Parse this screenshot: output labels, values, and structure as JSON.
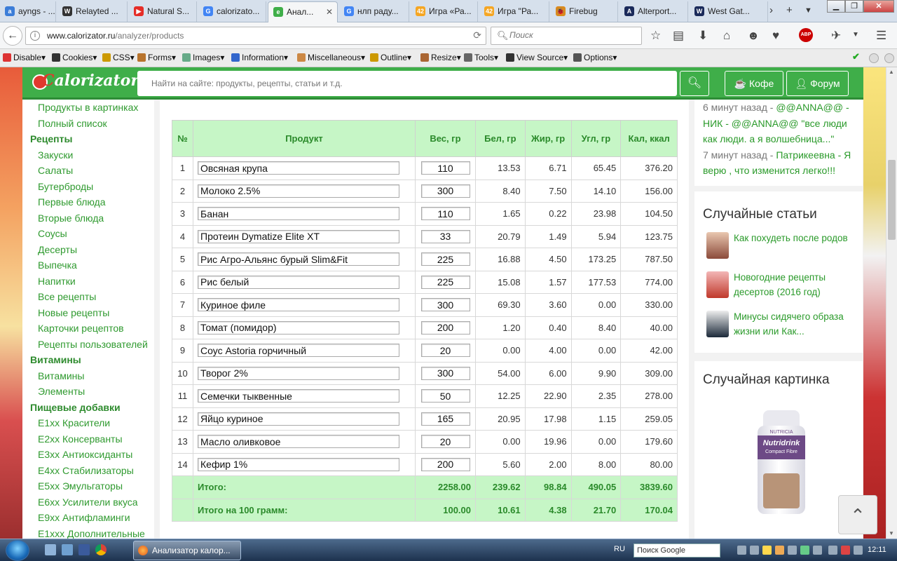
{
  "browser": {
    "tabs": [
      {
        "label": "ayngs - ...",
        "color": "#3b7dd8",
        "glyph": "a"
      },
      {
        "label": "Relayted ...",
        "color": "#333333",
        "glyph": "W"
      },
      {
        "label": "Natural S...",
        "color": "#e52d27",
        "glyph": "▶"
      },
      {
        "label": "calorizato...",
        "color": "#4285f4",
        "glyph": "G"
      },
      {
        "label": "Анал...",
        "color": "#3fae49",
        "glyph": "e",
        "active": true
      },
      {
        "label": "нлп раду...",
        "color": "#4285f4",
        "glyph": "G"
      },
      {
        "label": "Игра «Ра...",
        "color": "#f5a623",
        "glyph": "42"
      },
      {
        "label": "Игра \"Ра...",
        "color": "#f5a623",
        "glyph": "42"
      },
      {
        "label": "Firebug",
        "color": "#d98a1e",
        "glyph": "🐞"
      },
      {
        "label": "Alterport...",
        "color": "#1a2a5a",
        "glyph": "A"
      },
      {
        "label": "West Gat...",
        "color": "#1a2a5a",
        "glyph": "W"
      }
    ],
    "url_host": "www.calorizator.ru",
    "url_path": "/analyzer/products",
    "search_placeholder": "Поиск",
    "abp_label": "ABP"
  },
  "devbar": [
    {
      "label": "Disable",
      "color": "#d33"
    },
    {
      "label": "Cookies",
      "color": "#333"
    },
    {
      "label": "CSS",
      "color": "#c90"
    },
    {
      "label": "Forms",
      "color": "#b8742d"
    },
    {
      "label": "Images",
      "color": "#6a8"
    },
    {
      "label": "Information",
      "color": "#36c"
    },
    {
      "label": "Miscellaneous",
      "color": "#c84"
    },
    {
      "label": "Outline",
      "color": "#c90"
    },
    {
      "label": "Resize",
      "color": "#a63"
    },
    {
      "label": "Tools",
      "color": "#666"
    },
    {
      "label": "View Source",
      "color": "#333"
    },
    {
      "label": "Options",
      "color": "#555"
    }
  ],
  "site": {
    "logo": "alorizator",
    "logo_first": "C",
    "search_placeholder": "Найти на сайте: продукты, рецепты, статьи и т.д.",
    "coffee_label": "Кофе",
    "forum_label": "Форум"
  },
  "sidebar": [
    {
      "label": "Продукты в картинках",
      "type": "item"
    },
    {
      "label": "Полный список",
      "type": "item"
    },
    {
      "label": "Рецепты",
      "type": "cat"
    },
    {
      "label": "Закуски",
      "type": "item"
    },
    {
      "label": "Салаты",
      "type": "item"
    },
    {
      "label": "Бутерброды",
      "type": "item"
    },
    {
      "label": "Первые блюда",
      "type": "item"
    },
    {
      "label": "Вторые блюда",
      "type": "item"
    },
    {
      "label": "Соусы",
      "type": "item"
    },
    {
      "label": "Десерты",
      "type": "item"
    },
    {
      "label": "Выпечка",
      "type": "item"
    },
    {
      "label": "Напитки",
      "type": "item"
    },
    {
      "label": "Все рецепты",
      "type": "item"
    },
    {
      "label": "Новые рецепты",
      "type": "item"
    },
    {
      "label": "Карточки рецептов",
      "type": "item"
    },
    {
      "label": "Рецепты пользователей",
      "type": "item"
    },
    {
      "label": "Витамины",
      "type": "cat"
    },
    {
      "label": "Витамины",
      "type": "item"
    },
    {
      "label": "Элементы",
      "type": "item"
    },
    {
      "label": "Пищевые добавки",
      "type": "cat"
    },
    {
      "label": "E1xx Красители",
      "type": "item"
    },
    {
      "label": "E2xx Консерванты",
      "type": "item"
    },
    {
      "label": "E3xx Антиоксиданты",
      "type": "item"
    },
    {
      "label": "E4xx Стабилизаторы",
      "type": "item"
    },
    {
      "label": "E5xx Эмульгаторы",
      "type": "item"
    },
    {
      "label": "E6xx Усилители вкуса",
      "type": "item"
    },
    {
      "label": "E9xx Антифламинги",
      "type": "item"
    },
    {
      "label": "E1xxx Дополнительные",
      "type": "item"
    }
  ],
  "table": {
    "headers": [
      "№",
      "Продукт",
      "Вес, гр",
      "Бел, гр",
      "Жир, гр",
      "Угл, гр",
      "Кал, ккал"
    ],
    "rows": [
      [
        "1",
        "Овсяная крупа",
        "110",
        "13.53",
        "6.71",
        "65.45",
        "376.20"
      ],
      [
        "2",
        "Молоко 2.5%",
        "300",
        "8.40",
        "7.50",
        "14.10",
        "156.00"
      ],
      [
        "3",
        "Банан",
        "110",
        "1.65",
        "0.22",
        "23.98",
        "104.50"
      ],
      [
        "4",
        "Протеин Dymatize Elite XT",
        "33",
        "20.79",
        "1.49",
        "5.94",
        "123.75"
      ],
      [
        "5",
        "Рис Агро-Альянс бурый Slim&Fit",
        "225",
        "16.88",
        "4.50",
        "173.25",
        "787.50"
      ],
      [
        "6",
        "Рис белый",
        "225",
        "15.08",
        "1.57",
        "177.53",
        "774.00"
      ],
      [
        "7",
        "Куриное филе",
        "300",
        "69.30",
        "3.60",
        "0.00",
        "330.00"
      ],
      [
        "8",
        "Томат (помидор)",
        "200",
        "1.20",
        "0.40",
        "8.40",
        "40.00"
      ],
      [
        "9",
        "Соус Astoria горчичный",
        "20",
        "0.00",
        "4.00",
        "0.00",
        "42.00"
      ],
      [
        "10",
        "Творог 2%",
        "300",
        "54.00",
        "6.00",
        "9.90",
        "309.00"
      ],
      [
        "11",
        "Семечки тыквенные",
        "50",
        "12.25",
        "22.90",
        "2.35",
        "278.00"
      ],
      [
        "12",
        "Яйцо куриное",
        "165",
        "20.95",
        "17.98",
        "1.15",
        "259.05"
      ],
      [
        "13",
        "Масло оливковое",
        "20",
        "0.00",
        "19.96",
        "0.00",
        "179.60"
      ],
      [
        "14",
        "Кефир 1%",
        "200",
        "5.60",
        "2.00",
        "8.00",
        "80.00"
      ]
    ],
    "totals": [
      [
        "Итого:",
        "2258.00",
        "239.62",
        "98.84",
        "490.05",
        "3839.60"
      ],
      [
        "Итого на 100 грамм:",
        "100.00",
        "10.61",
        "4.38",
        "21.70",
        "170.04"
      ]
    ]
  },
  "comments": [
    {
      "time": "6 минут назад - ",
      "user": "@@ANNA@@",
      "text": " - НИК - @@ANNA@@ \"все люди как люди. а я волшебница...\""
    },
    {
      "time": "7 минут назад - ",
      "user": "Патрикеевна",
      "text": " - Я верю , что изменится легко!!!"
    }
  ],
  "random_articles": {
    "title": "Случайные статьи",
    "items": [
      "Как похудеть после родов",
      "Новогодние рецепты десертов (2016 год)",
      "Минусы сидячего образа жизни или Как..."
    ]
  },
  "random_picture": {
    "title": "Случайная картинка",
    "brand": "Nutridrink",
    "maker": "NUTRICIA",
    "subtitle": "Compact Fibre"
  },
  "taskbar": {
    "app_label": "Анализатор калор...",
    "lang": "RU",
    "search": "Поиск Google",
    "clock": "12:11"
  }
}
